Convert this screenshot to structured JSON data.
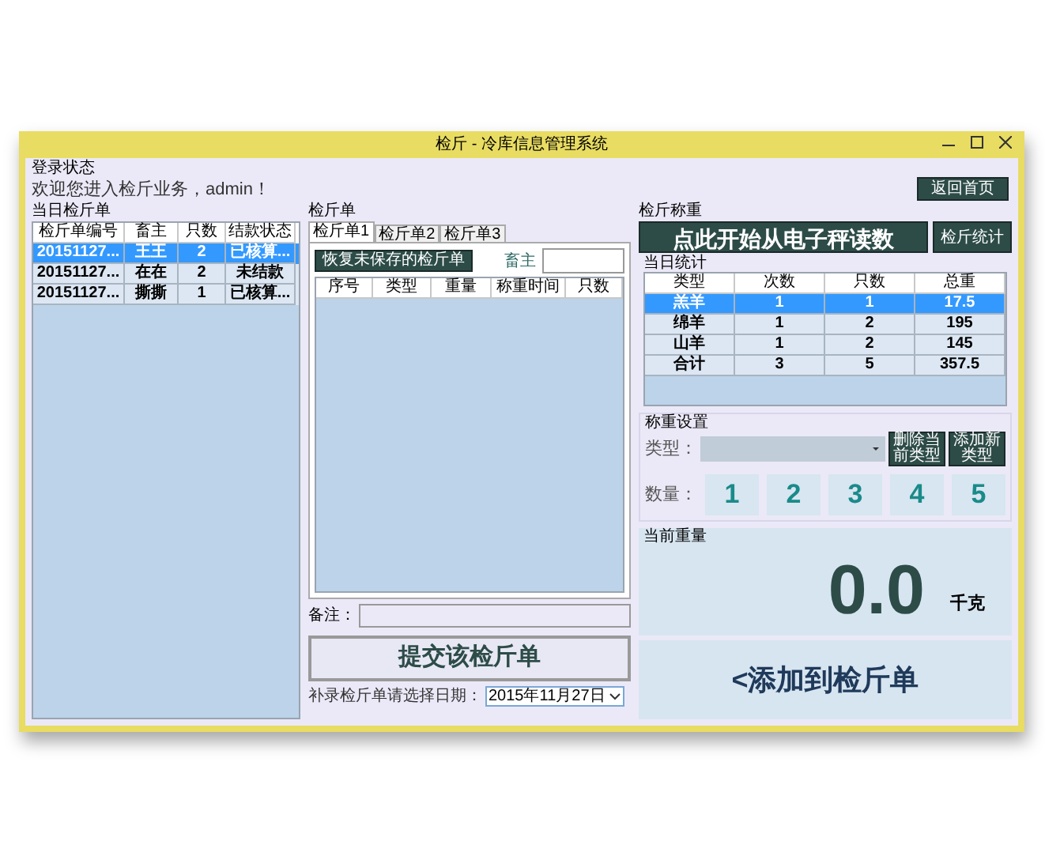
{
  "window": {
    "title": "检斤 - 冷库信息管理系统"
  },
  "login": {
    "label": "登录状态",
    "welcome": "欢迎您进入检斤业务，admin！",
    "home_button": "返回首页"
  },
  "today_orders": {
    "label": "当日检斤单",
    "columns": [
      "检斤单编号",
      "畜主",
      "只数",
      "结款状态"
    ],
    "rows": [
      {
        "cells": [
          "20151127...",
          "王王",
          "2",
          "已核算..."
        ],
        "selected": true
      },
      {
        "cells": [
          "20151127...",
          "在在",
          "2",
          "未结款"
        ],
        "selected": false
      },
      {
        "cells": [
          "20151127...",
          "撕撕",
          "1",
          "已核算..."
        ],
        "selected": false
      }
    ]
  },
  "order": {
    "label": "检斤单",
    "tabs": [
      {
        "label": "检斤单1",
        "selected": true
      },
      {
        "label": "检斤单2",
        "selected": false
      },
      {
        "label": "检斤单3",
        "selected": false
      }
    ],
    "restore_button": "恢复未保存的检斤单",
    "owner_label": "畜主",
    "columns": [
      "序号",
      "类型",
      "重量",
      "称重时间",
      "只数"
    ],
    "remark_label": "备注：",
    "submit_button": "提交该检斤单",
    "date_label": "补录检斤单请选择日期：",
    "date_value": "2015年11月27日"
  },
  "weighing": {
    "label": "检斤称重",
    "read_button": "点此开始从电子秤读数",
    "stats_button": "检斤统计",
    "stats": {
      "label": "当日统计",
      "columns": [
        "类型",
        "次数",
        "只数",
        "总重"
      ],
      "rows": [
        {
          "cells": [
            "羔羊",
            "1",
            "1",
            "17.5"
          ],
          "selected": true
        },
        {
          "cells": [
            "绵羊",
            "1",
            "2",
            "195"
          ],
          "selected": false
        },
        {
          "cells": [
            "山羊",
            "1",
            "2",
            "145"
          ],
          "selected": false
        },
        {
          "cells": [
            "合计",
            "3",
            "5",
            "357.5"
          ],
          "selected": false
        }
      ]
    },
    "settings": {
      "label": "称重设置",
      "type_label": "类型：",
      "delete_button": "删除当前类型",
      "add_type_button": "添加新类型",
      "count_label": "数量：",
      "counts": [
        "1",
        "2",
        "3",
        "4",
        "5"
      ]
    },
    "current": {
      "label": "当前重量",
      "value": "0.0",
      "unit": "千克"
    },
    "add_button": "<添加到检斤单"
  }
}
